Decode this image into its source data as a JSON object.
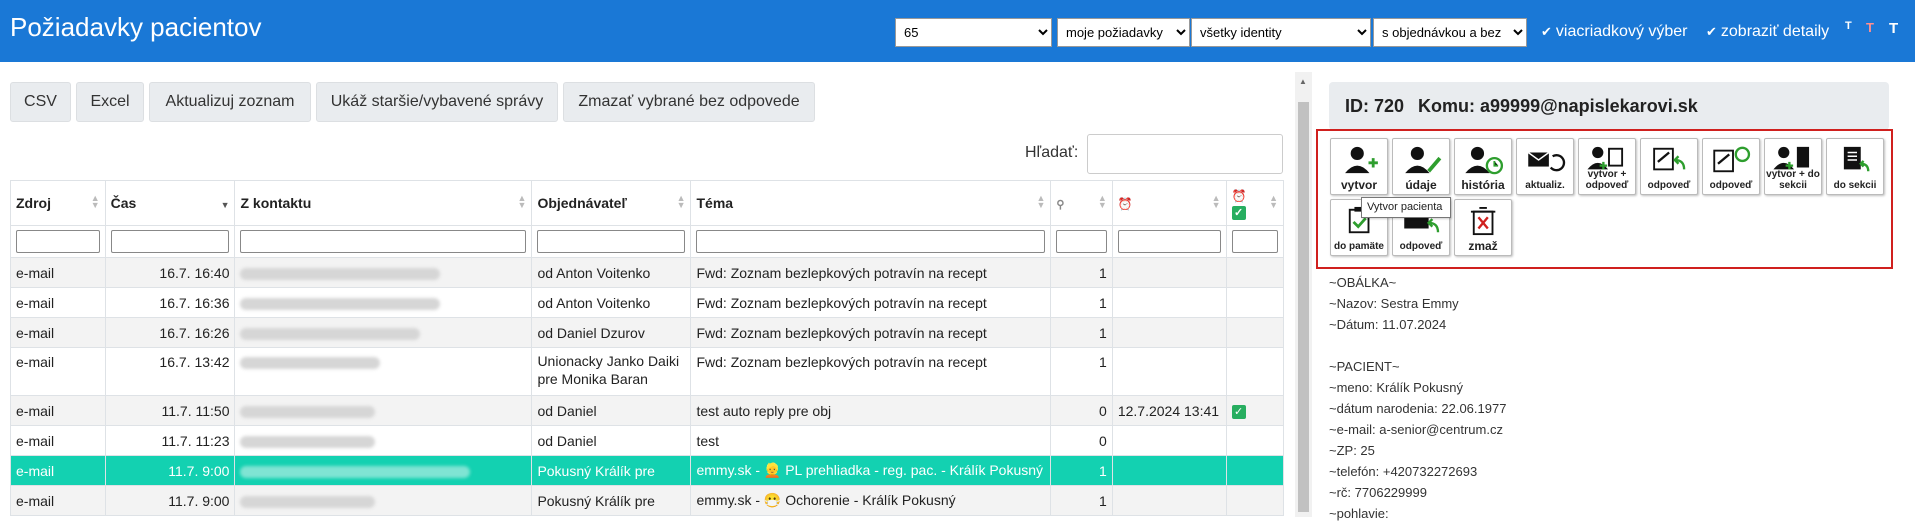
{
  "header": {
    "title": "Požiadavky pacientov",
    "selects": [
      "65",
      "moje požiadavky",
      "všetky identity",
      "s objednávkou a bez"
    ],
    "checks": [
      "viacriadkový výber",
      "zobraziť detaily"
    ],
    "font_buttons": [
      "T",
      "T",
      "T"
    ]
  },
  "toolbar": {
    "buttons": [
      "CSV",
      "Excel",
      "Aktualizuj zoznam",
      "Ukáž staršie/vybavené správy",
      "Zmazať vybrané bez odpovede"
    ]
  },
  "search": {
    "label": "Hľadať:"
  },
  "table": {
    "columns": [
      "Zdroj",
      "Čas",
      "Z kontaktu",
      "Objednávateľ",
      "Téma",
      "",
      "",
      ""
    ],
    "rows": [
      {
        "source": "e-mail",
        "time": "16.7. 16:40",
        "orderer": "od Anton Voitenko",
        "topic": "Fwd: Zoznam bezlepkových potravín na recept",
        "count": "1",
        "alarm": "",
        "done": ""
      },
      {
        "source": "e-mail",
        "time": "16.7. 16:36",
        "orderer": "od Anton Voitenko",
        "topic": "Fwd: Zoznam bezlepkových potravín na recept",
        "count": "1",
        "alarm": "",
        "done": ""
      },
      {
        "source": "e-mail",
        "time": "16.7. 16:26",
        "orderer": "od Daniel Dzurov",
        "topic": "Fwd: Zoznam bezlepkových potravín na recept",
        "count": "1",
        "alarm": "",
        "done": ""
      },
      {
        "source": "e-mail",
        "time": "16.7. 13:42",
        "orderer": "Unionacky Janko Daiki pre Monika Baran",
        "topic": "Fwd: Zoznam bezlepkových potravín na recept",
        "count": "1",
        "alarm": "",
        "done": ""
      },
      {
        "source": "e-mail",
        "time": "11.7. 11:50",
        "orderer": "od Daniel",
        "topic": "test auto reply pre obj",
        "count": "0",
        "alarm": "12.7.2024 13:41",
        "done": "✓"
      },
      {
        "source": "e-mail",
        "time": "11.7. 11:23",
        "orderer": "od Daniel",
        "topic": "test",
        "count": "0",
        "alarm": "",
        "done": ""
      },
      {
        "source": "e-mail",
        "time": "11.7. 9:00",
        "orderer": "Pokusný Králík pre",
        "topic": "emmy.sk - 👱 PL prehliadka - reg. pac. - Králík Pokusný",
        "count": "1",
        "alarm": "",
        "done": ""
      },
      {
        "source": "e-mail",
        "time": "11.7. 9:00",
        "orderer": "Pokusný Králík pre",
        "topic": "emmy.sk - 😷 Ochorenie - Králík Pokusný",
        "count": "1",
        "alarm": "",
        "done": ""
      }
    ]
  },
  "detail": {
    "id_label": "ID: 720",
    "to_label": "Komu: a99999@napislekarovi.sk",
    "tooltip": "Vytvor pacienta",
    "actions": [
      {
        "name": "vytvor",
        "label": "vytvor"
      },
      {
        "name": "udaje",
        "label": "údaje"
      },
      {
        "name": "historia",
        "label": "história"
      },
      {
        "name": "aktualiz",
        "label": "aktualiz."
      },
      {
        "name": "vytvor-odpoved",
        "label": "vytvor + odpoveď"
      },
      {
        "name": "odpoved-1",
        "label": "odpoveď"
      },
      {
        "name": "odpoved-2",
        "label": "odpoveď"
      },
      {
        "name": "vytvor-do-sekcii",
        "label": "vytvor + do sekcii"
      },
      {
        "name": "do-sekcii",
        "label": "do sekcii"
      },
      {
        "name": "do-pamate",
        "label": "do pamäte"
      },
      {
        "name": "odpoved-3",
        "label": "odpoveď"
      },
      {
        "name": "zmaz",
        "label": "zmaž"
      }
    ],
    "message": "~OBÁLKA~\n~Nazov: Sestra Emmy\n~Dátum: 11.07.2024\n\n~PACIENT~\n~meno: Králík Pokusný\n~dátum narodenia: 22.06.1977\n~e-mail: a-senior@centrum.cz\n~ZP: 25\n~telefón: +420732272693\n~rč: 7706229999\n~pohlavie:"
  }
}
